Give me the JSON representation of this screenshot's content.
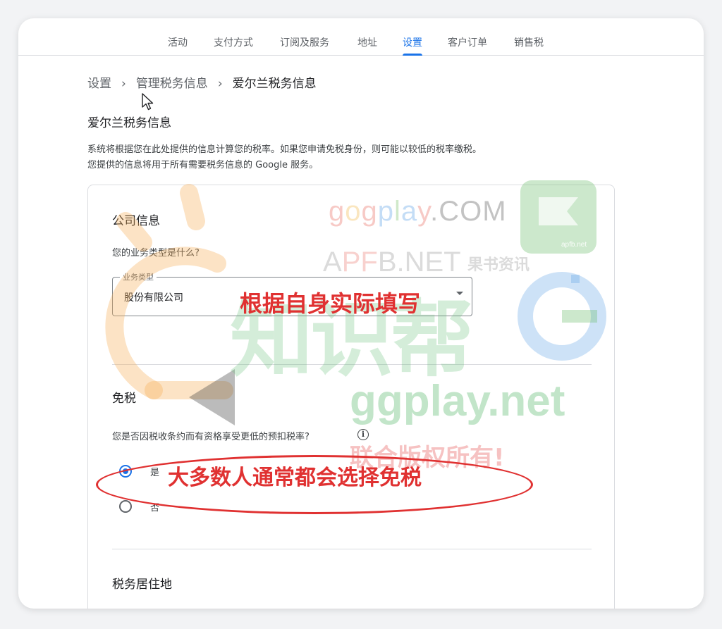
{
  "tabs": [
    {
      "label": "活动",
      "active": false
    },
    {
      "label": "支付方式",
      "active": false
    },
    {
      "label": "订阅及服务",
      "active": false
    },
    {
      "label": "地址",
      "active": false
    },
    {
      "label": "设置",
      "active": true
    },
    {
      "label": "客户订单",
      "active": false
    },
    {
      "label": "销售税",
      "active": false
    }
  ],
  "breadcrumb": {
    "items": [
      "设置",
      "管理税务信息",
      "爱尔兰税务信息"
    ],
    "separator": "›"
  },
  "page": {
    "title": "爱尔兰税务信息",
    "description": "系统将根据您在此处提供的信息计算您的税率。如果您申请免税身份，则可能以较低的税率缴税。您提供的信息将用于所有需要税务信息的 Google 服务。"
  },
  "company_section": {
    "title": "公司信息",
    "question": "您的业务类型是什么?",
    "field_label": "业务类型",
    "field_value": "股份有限公司"
  },
  "exemption_section": {
    "title": "免税",
    "question": "您是否因税收条约而有资格享受更低的预扣税率?",
    "info_icon": "i",
    "options": [
      {
        "label": "是",
        "selected": true
      },
      {
        "label": "否",
        "selected": false
      }
    ]
  },
  "residence_section": {
    "title": "税务居住地"
  },
  "annotations": {
    "fill_hint": "根据自身实际填写",
    "exempt_hint": "大多数人通常都会选择免税",
    "color": "#e03131"
  },
  "watermarks": {
    "gogplay": {
      "parts": [
        "g",
        "o",
        "g",
        "p",
        "l",
        "a",
        "y"
      ],
      "suffix": ".COM"
    },
    "apfb_prefix": "A",
    "apfb_pf": "PF",
    "apfb_suffix": "B.NET",
    "guoshu": "果书资讯",
    "zhishibang": "知识帮",
    "ggplay": "ggplay.net",
    "copyright": "联合版权所有!",
    "apfb_badge": "apfb.net"
  },
  "icons": {
    "cursor": "mouse-pointer-icon",
    "info": "info-circle-icon",
    "dropdown": "chevron-down-icon"
  }
}
